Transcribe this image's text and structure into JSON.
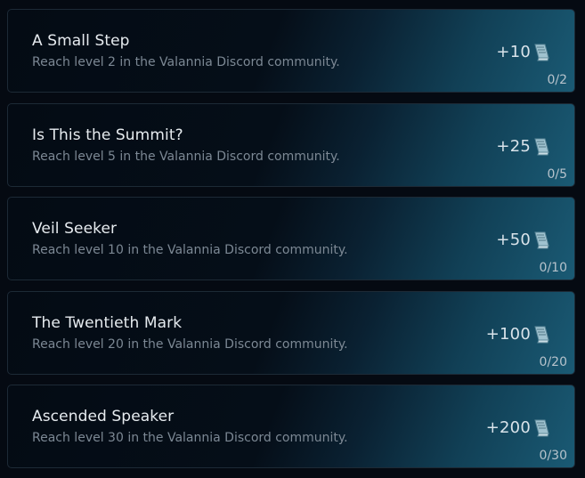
{
  "achievements": [
    {
      "title": "A Small Step",
      "description": "Reach level 2 in the Valannia Discord community.",
      "reward": "+10",
      "progress": "0/2"
    },
    {
      "title": "Is This the Summit?",
      "description": "Reach level 5 in the Valannia Discord community.",
      "reward": "+25",
      "progress": "0/5"
    },
    {
      "title": "Veil Seeker",
      "description": "Reach level 10 in the Valannia Discord community.",
      "reward": "+50",
      "progress": "0/10"
    },
    {
      "title": "The Twentieth Mark",
      "description": "Reach level 20 in the Valannia Discord community.",
      "reward": "+100",
      "progress": "0/20"
    },
    {
      "title": "Ascended Speaker",
      "description": "Reach level 30 in the Valannia Discord community.",
      "reward": "+200",
      "progress": "0/30"
    }
  ],
  "reward_icon": "scroll-icon"
}
